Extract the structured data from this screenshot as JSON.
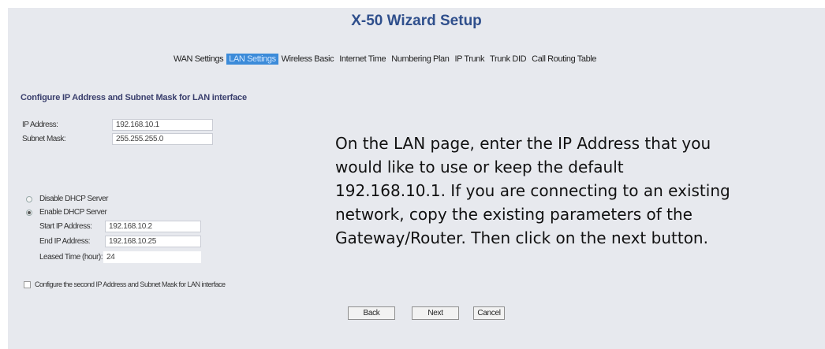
{
  "header": {
    "title": "X-50 Wizard Setup"
  },
  "tabs": [
    {
      "label": "WAN Settings"
    },
    {
      "label": "LAN Settings"
    },
    {
      "label": "Wireless Basic"
    },
    {
      "label": "Internet Time"
    },
    {
      "label": "Numbering Plan"
    },
    {
      "label": "IP Trunk"
    },
    {
      "label": "Trunk DID"
    },
    {
      "label": "Call Routing Table"
    }
  ],
  "active_tab": "LAN Settings",
  "lan": {
    "section_title": "Configure IP Address and Subnet Mask for LAN interface",
    "ip_label": "IP Address:",
    "ip_value": "192.168.10.1",
    "mask_label": "Subnet Mask:",
    "mask_value": "255.255.255.0"
  },
  "dhcp": {
    "disable_label": "Disable DHCP Server",
    "enable_label": "Enable DHCP Server",
    "selected": "Enable DHCP Server",
    "start_label": "Start IP Address:",
    "start_value": "192.168.10.2",
    "end_label": "End IP Address:",
    "end_value": "192.168.10.25",
    "lease_label": "Leased Time (hour):",
    "lease_value": "24"
  },
  "second_ip": {
    "label": "Configure the second IP Address and Subnet Mask for LAN interface",
    "checked": false
  },
  "buttons": {
    "back": "Back",
    "next": "Next",
    "cancel": "Cancel"
  },
  "description": {
    "lines": [
      "On the LAN page, enter the IP Address that you",
      "would like to use or keep the default",
      "192.168.10.1. If you are connecting to an existing",
      "network, copy the existing parameters of the",
      "Gateway/Router.  Then click on the next button."
    ]
  },
  "colors": {
    "panel_bg": "#e7e9ee",
    "title": "#2f4f8c",
    "active_tab_bg": "#3c8bd9"
  }
}
